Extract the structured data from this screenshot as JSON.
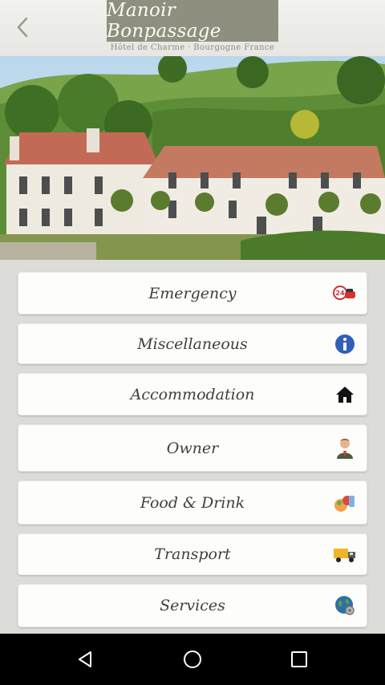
{
  "header": {
    "logo_text": "Manoir Bonpassage",
    "tagline": "Hôtel de Charme · Bourgogne France"
  },
  "hero": {
    "image": "photo of the manor house and hillside"
  },
  "menu": [
    {
      "label": "Emergency",
      "icon": "emergency-24h-icon"
    },
    {
      "label": "Miscellaneous",
      "icon": "info-icon"
    },
    {
      "label": "Accommodation",
      "icon": "home-icon"
    },
    {
      "label": "Owner",
      "icon": "owner-icon"
    },
    {
      "label": "Food & Drink",
      "icon": "food-drink-icon"
    },
    {
      "label": "Transport",
      "icon": "truck-icon"
    },
    {
      "label": "Services",
      "icon": "globe-gear-icon"
    }
  ],
  "navbar": {
    "back": "nav-back-icon",
    "home": "nav-home-icon",
    "recents": "nav-recents-icon"
  },
  "colors": {
    "logo_bg": "#8e8f7e",
    "content_bg": "#dcdcd8",
    "button_bg": "#fdfdfb",
    "navbar_bg": "#000000"
  }
}
